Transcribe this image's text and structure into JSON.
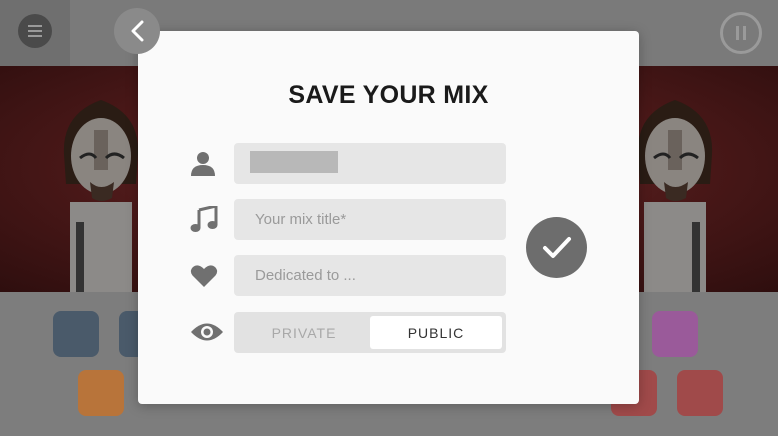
{
  "dialog": {
    "title": "SAVE YOUR MIX",
    "fields": {
      "username_value": "",
      "mix_title_placeholder": "Your mix title*",
      "dedicated_placeholder": "Dedicated to ..."
    },
    "visibility": {
      "options": [
        "PRIVATE",
        "PUBLIC"
      ],
      "selected": "PUBLIC"
    }
  },
  "icons": {
    "menu": "hamburger-icon",
    "pause": "pause-icon",
    "back": "chevron-left-icon",
    "user": "user-icon",
    "music": "music-note-icon",
    "heart": "heart-icon",
    "eye": "eye-icon",
    "confirm": "checkmark-icon"
  },
  "colors": {
    "dialog_bg": "#fafafa",
    "field_bg": "#e6e6e6",
    "icon_gray": "#707070",
    "confirm_bg": "#6d6d6d"
  }
}
